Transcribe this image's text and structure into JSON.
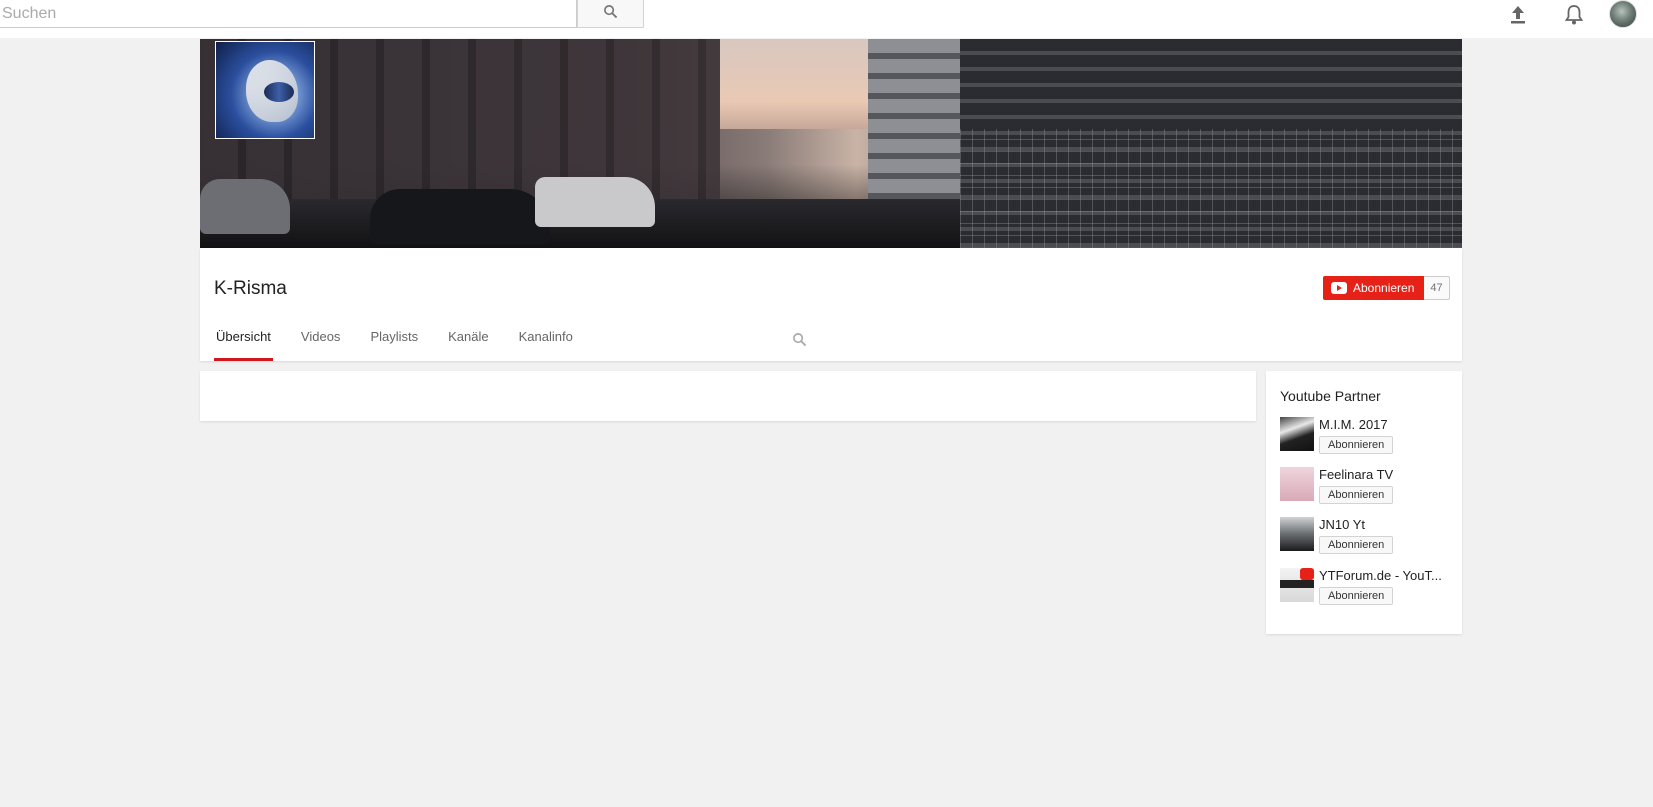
{
  "topbar": {
    "search_placeholder": "Suchen"
  },
  "channel": {
    "title": "K-Risma",
    "subscribe_label": "Abonnieren",
    "subscriber_count": "47"
  },
  "tabs": [
    {
      "label": "Übersicht",
      "active": true
    },
    {
      "label": "Videos",
      "active": false
    },
    {
      "label": "Playlists",
      "active": false
    },
    {
      "label": "Kanäle",
      "active": false
    },
    {
      "label": "Kanalinfo",
      "active": false
    }
  ],
  "sidebar": {
    "title": "Youtube Partner",
    "partners": [
      {
        "name": "M.I.M. 2017",
        "button": "Abonnieren"
      },
      {
        "name": "Feelinara TV",
        "button": "Abonnieren"
      },
      {
        "name": "JN10 Yt",
        "button": "Abonnieren"
      },
      {
        "name": "YTForum.de - YouT...",
        "button": "Abonnieren"
      }
    ]
  },
  "colors": {
    "accent_red": "#e62117",
    "tab_underline": "#cc181e",
    "page_background": "#f1f1f1"
  }
}
